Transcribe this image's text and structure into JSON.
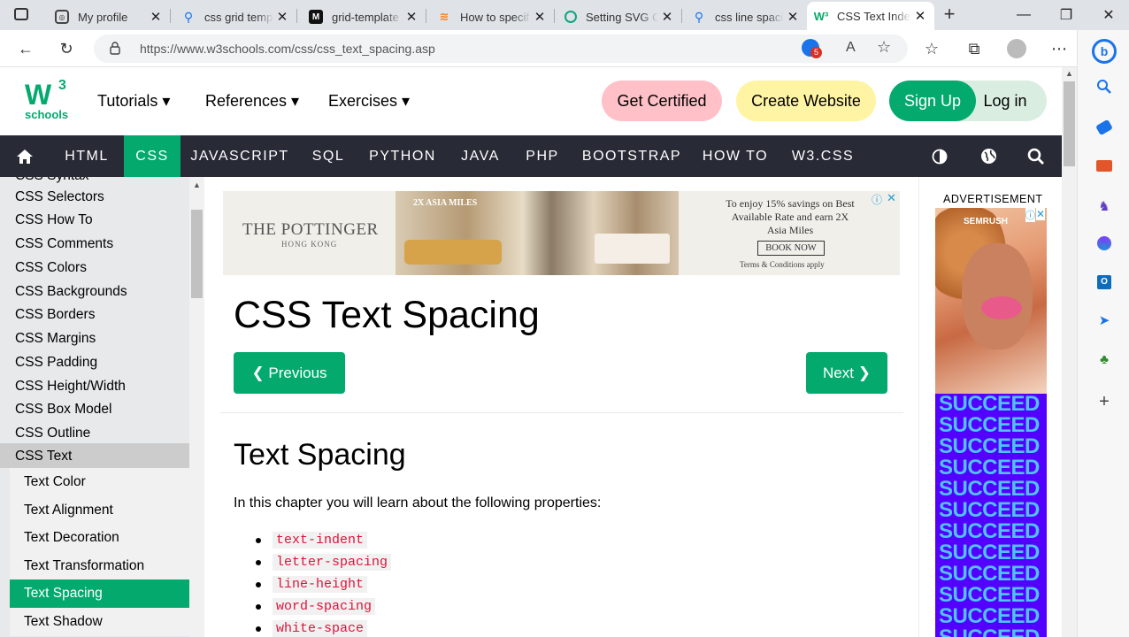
{
  "browser": {
    "tabs": [
      {
        "title": "My profile",
        "favicon": "profile-icon"
      },
      {
        "title": "css grid temp",
        "favicon": "search-icon"
      },
      {
        "title": "grid-template",
        "favicon": "mdn-icon"
      },
      {
        "title": "How to specif",
        "favicon": "stackoverflow-icon"
      },
      {
        "title": "Setting SVG C",
        "favicon": "chatgpt-icon"
      },
      {
        "title": "css line spacin",
        "favicon": "search-icon"
      },
      {
        "title": "CSS Text Inde",
        "favicon": "w3schools-icon",
        "active": true
      }
    ],
    "new_tab": "+",
    "url": "https://www.w3schools.com/css/css_text_spacing.asp",
    "extension_badge": "5",
    "read_aloud": "A",
    "minimize": "—",
    "restore": "❐",
    "close": "✕"
  },
  "topnav": {
    "logo_main": "W",
    "logo_sup": "3",
    "logo_sub": "schools",
    "links": [
      "Tutorials ▾",
      "References ▾",
      "Exercises ▾"
    ],
    "get_certified": "Get Certified",
    "create_website": "Create Website",
    "sign_up": "Sign Up",
    "log_in": "Log in"
  },
  "menubar": {
    "items": [
      "HTML",
      "CSS",
      "JAVASCRIPT",
      "SQL",
      "PYTHON",
      "JAVA",
      "PHP",
      "BOOTSTRAP",
      "HOW TO",
      "W3.CSS"
    ],
    "active": "CSS"
  },
  "sidebar": {
    "partial": "CSS Syntax",
    "items": [
      "CSS Selectors",
      "CSS How To",
      "CSS Comments",
      "CSS Colors",
      "CSS Backgrounds",
      "CSS Borders",
      "CSS Margins",
      "CSS Padding",
      "CSS Height/Width",
      "CSS Box Model",
      "CSS Outline"
    ],
    "current_section": "CSS Text",
    "subitems": [
      "Text Color",
      "Text Alignment",
      "Text Decoration",
      "Text Transformation",
      "Text Spacing",
      "Text Shadow"
    ],
    "active_subitem": "Text Spacing"
  },
  "ad_banner": {
    "brand": "THE POTTINGER",
    "brand_sub": "HONG KONG",
    "tag": "2X ASIA MILES",
    "offer": "To enjoy 15% savings on Best Available Rate and earn 2X Asia Miles",
    "cta": "BOOK NOW",
    "terms": "Terms & Conditions apply"
  },
  "main": {
    "title": "CSS Text Spacing",
    "prev_label": "❮ Previous",
    "next_label": "Next ❯",
    "section_title": "Text Spacing",
    "intro": "In this chapter you will learn about the following properties:",
    "properties": [
      "text-indent",
      "letter-spacing",
      "line-height",
      "word-spacing",
      "white-space"
    ]
  },
  "right_ad": {
    "label": "ADVERTISEMENT",
    "brand": "SEMRUSH",
    "word": "SUCCEED"
  }
}
